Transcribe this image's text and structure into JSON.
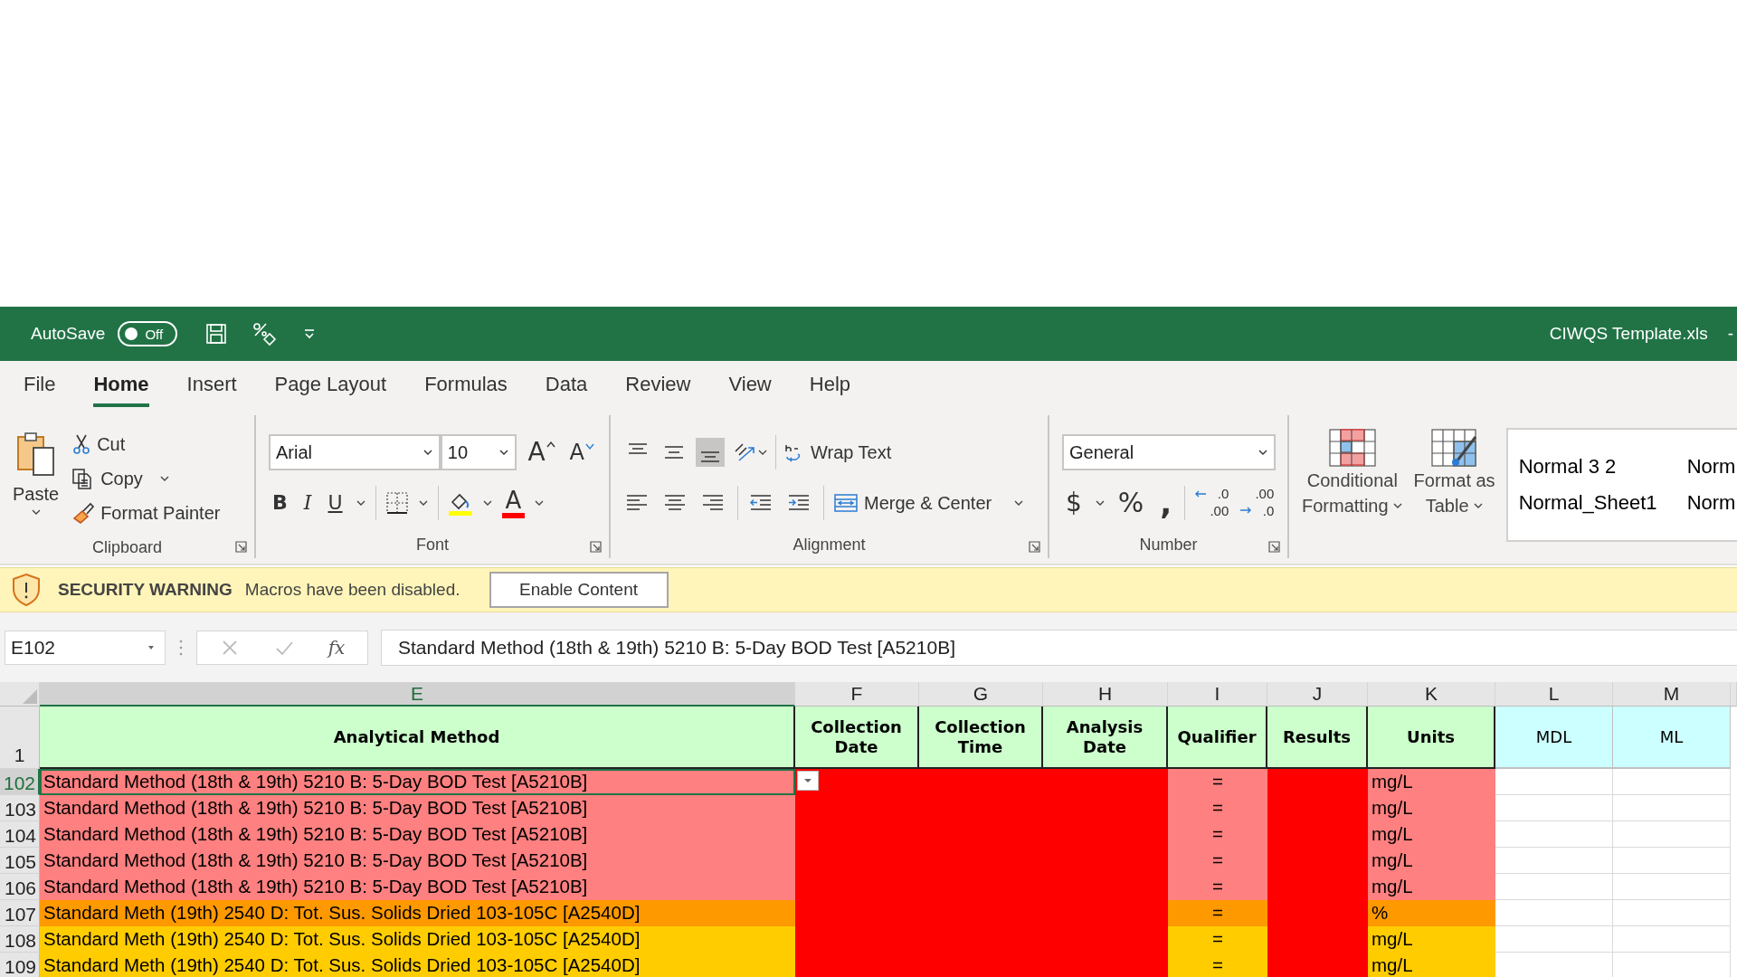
{
  "title_bar": {
    "autosave_label": "AutoSave",
    "autosave_toggle": {
      "label": "Off",
      "on": false
    },
    "document_title": "CIWQS Template.xls",
    "title_suffix": "-"
  },
  "tabs": [
    {
      "label": "File",
      "selected": false
    },
    {
      "label": "Home",
      "selected": true
    },
    {
      "label": "Insert",
      "selected": false
    },
    {
      "label": "Page Layout",
      "selected": false
    },
    {
      "label": "Formulas",
      "selected": false
    },
    {
      "label": "Data",
      "selected": false
    },
    {
      "label": "Review",
      "selected": false
    },
    {
      "label": "View",
      "selected": false
    },
    {
      "label": "Help",
      "selected": false
    }
  ],
  "ribbon": {
    "clipboard": {
      "paste": "Paste",
      "cut": "Cut",
      "copy": "Copy",
      "format_painter": "Format Painter",
      "group_label": "Clipboard"
    },
    "font": {
      "font_name": "Arial",
      "font_size": "10",
      "grow_font": "A",
      "shrink_font": "A",
      "bold": "B",
      "italic": "I",
      "underline": "U",
      "font_color": "A",
      "group_label": "Font"
    },
    "alignment": {
      "wrap_text": "Wrap Text",
      "merge_center": "Merge & Center",
      "bottom_align_selected": true,
      "group_label": "Alignment"
    },
    "number": {
      "format": "General",
      "currency": "$",
      "percent": "%",
      "comma": ",",
      "increase_decimal": [
        ".0",
        ".00"
      ],
      "decrease_decimal": [
        ".00",
        ".0"
      ],
      "group_label": "Number"
    },
    "styles": {
      "conditional_formatting": [
        "Conditional",
        "Formatting"
      ],
      "format_as_table": [
        "Format as",
        "Table"
      ],
      "cell_styles": [
        "Normal 3 2",
        "Norm",
        "Normal_Sheet1",
        "Norm"
      ]
    }
  },
  "security_bar": {
    "title": "SECURITY WARNING",
    "message": "Macros have been disabled.",
    "button": "Enable Content"
  },
  "formula_bar": {
    "name_box": "E102",
    "fx": "fx",
    "formula": "Standard Method (18th & 19th) 5210 B: 5-Day BOD Test [A5210B]"
  },
  "sheet": {
    "columns": [
      {
        "letter": "E",
        "selected": true
      },
      {
        "letter": "F",
        "selected": false
      },
      {
        "letter": "G",
        "selected": false
      },
      {
        "letter": "H",
        "selected": false
      },
      {
        "letter": "I",
        "selected": false
      },
      {
        "letter": "J",
        "selected": false
      },
      {
        "letter": "K",
        "selected": false
      },
      {
        "letter": "L",
        "selected": false
      },
      {
        "letter": "M",
        "selected": false
      }
    ],
    "header_row": {
      "number": "1",
      "cells": [
        {
          "label": "Analytical Method",
          "kind": "required"
        },
        {
          "label": "Collection Date",
          "kind": "required"
        },
        {
          "label": "Collection Time",
          "kind": "required"
        },
        {
          "label": "Analysis Date",
          "kind": "required"
        },
        {
          "label": "Qualifier",
          "kind": "required"
        },
        {
          "label": "Results",
          "kind": "required"
        },
        {
          "label": "Units",
          "kind": "required"
        },
        {
          "label": "MDL",
          "kind": "optional"
        },
        {
          "label": "ML",
          "kind": "optional"
        }
      ]
    },
    "rows": [
      {
        "number": "102",
        "method": "Standard Method (18th & 19th) 5210 B: 5-Day BOD Test [A5210B]",
        "qualifier": "=",
        "units": "mg/L",
        "color": "#ff8080",
        "selected": true
      },
      {
        "number": "103",
        "method": "Standard Method (18th & 19th) 5210 B: 5-Day BOD Test [A5210B]",
        "qualifier": "=",
        "units": "mg/L",
        "color": "#ff8080",
        "selected": false
      },
      {
        "number": "104",
        "method": "Standard Method (18th & 19th) 5210 B: 5-Day BOD Test [A5210B]",
        "qualifier": "=",
        "units": "mg/L",
        "color": "#ff8080",
        "selected": false
      },
      {
        "number": "105",
        "method": "Standard Method (18th & 19th) 5210 B: 5-Day BOD Test [A5210B]",
        "qualifier": "=",
        "units": "mg/L",
        "color": "#ff8080",
        "selected": false
      },
      {
        "number": "106",
        "method": "Standard Method (18th & 19th) 5210 B: 5-Day BOD Test [A5210B]",
        "qualifier": "=",
        "units": "mg/L",
        "color": "#ff8080",
        "selected": false
      },
      {
        "number": "107",
        "method": "Standard Meth (19th) 2540 D: Tot. Sus. Solids Dried 103-105C [A2540D]",
        "qualifier": "=",
        "units": "%",
        "color": "#ff9900",
        "selected": false
      },
      {
        "number": "108",
        "method": "Standard Meth (19th) 2540 D: Tot. Sus. Solids Dried 103-105C [A2540D]",
        "qualifier": "=",
        "units": "mg/L",
        "color": "#ffcc00",
        "selected": false
      },
      {
        "number": "109",
        "method": "Standard Meth (19th) 2540 D: Tot. Sus. Solids Dried 103-105C [A2540D]",
        "qualifier": "=",
        "units": "mg/L",
        "color": "#ffcc00",
        "selected": false
      }
    ]
  }
}
